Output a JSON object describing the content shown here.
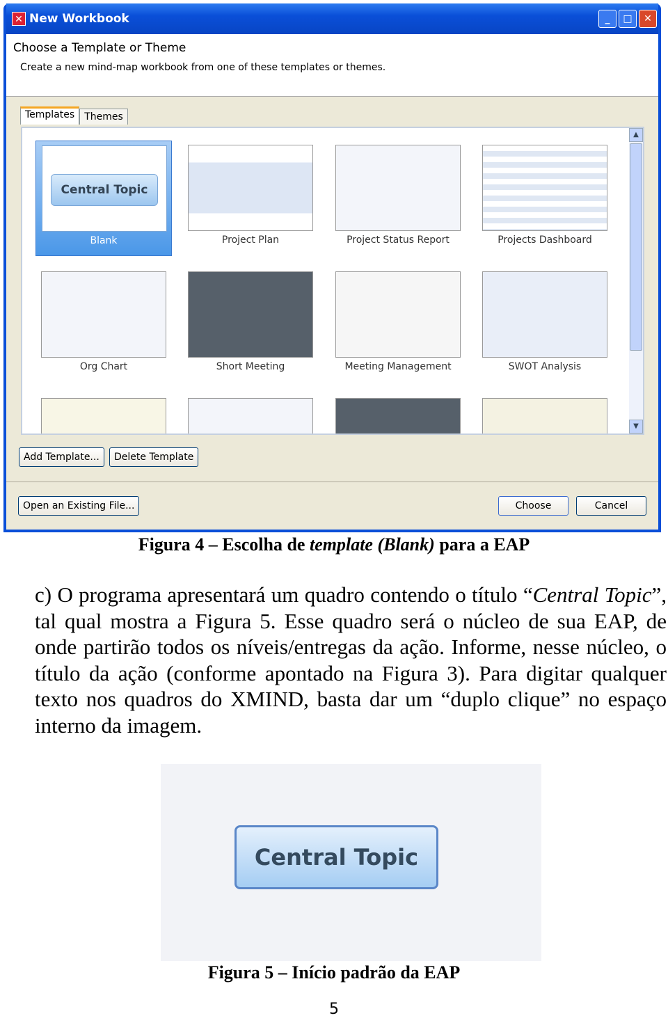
{
  "dialog": {
    "title": "New Workbook",
    "heading": "Choose a Template or Theme",
    "description": "Create a new mind-map workbook from one of these templates or themes.",
    "tabs": [
      "Templates",
      "Themes"
    ],
    "templates": [
      {
        "label": "Blank",
        "preview": "Central Topic"
      },
      {
        "label": "Project Plan"
      },
      {
        "label": "Project Status Report"
      },
      {
        "label": "Projects Dashboard"
      },
      {
        "label": "Org Chart"
      },
      {
        "label": "Short Meeting"
      },
      {
        "label": "Meeting Management"
      },
      {
        "label": "SWOT Analysis"
      }
    ],
    "selected": "Blank",
    "buttons": {
      "add": "Add Template...",
      "delete": "Delete Template",
      "open": "Open an Existing File...",
      "choose": "Choose",
      "cancel": "Cancel"
    }
  },
  "caption4": {
    "a": "Figura 4 – Escolha de ",
    "b": "template (Blank)",
    "c": " para a EAP"
  },
  "paragraph": {
    "p1": "c) O programa apresentará um quadro contendo o título “",
    "p2": "Central Topic",
    "p3": "”, tal qual mostra a Figura 5. Esse quadro será o núcleo de sua EAP, de onde partirão todos os níveis/entregas da ação. Informe, nesse núcleo, o título da ação (conforme apontado na Figura 3). Para digitar qualquer texto nos quadros do XMIND, basta dar um “duplo clique” no espaço interno da imagem."
  },
  "figure5": {
    "topic": "Central Topic"
  },
  "caption5": "Figura 5 – Início padrão da EAP",
  "page_number": "5"
}
